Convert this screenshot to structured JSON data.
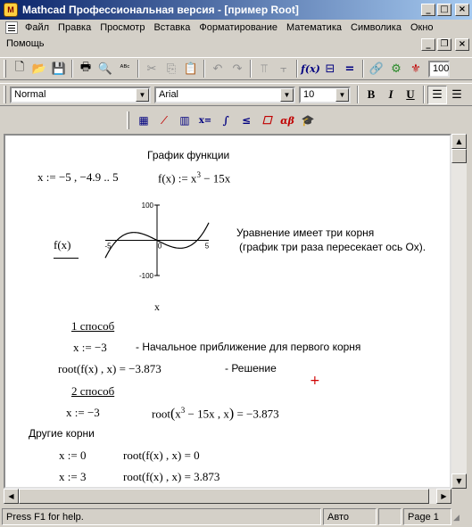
{
  "window": {
    "title": "Mathcad Профессиональная версия - [пример Root]",
    "app_icon_letter": "M",
    "min": "_",
    "max": "□",
    "close": "×"
  },
  "menu": {
    "items": [
      "Файл",
      "Правка",
      "Просмотр",
      "Вставка",
      "Форматирование",
      "Математика",
      "Символика",
      "Окно"
    ],
    "help": "Помощь"
  },
  "mdi": {
    "min": "_",
    "restore": "❐",
    "close": "×"
  },
  "toolbar": {
    "zoom_value": "100"
  },
  "format_toolbar": {
    "style": "Normal",
    "font": "Arial",
    "size": "10",
    "bold": "B",
    "italic": "I",
    "underline": "U"
  },
  "math_toolbar": {
    "buttons": [
      "▦",
      "⁄",
      "▥",
      "x=",
      "∫",
      "≤",
      "☐",
      "αβ",
      "🎓"
    ]
  },
  "worksheet": {
    "heading": "График функции",
    "range_def": "x := −5 , −4.9 .. 5",
    "func_def_lhs": "f(x) := x",
    "func_def_exp": "3",
    "func_def_rhs": " − 15x",
    "plot_ylabel": "f(x)",
    "plot_xlabel": "x",
    "plot_note_1": "Уравнение имеет три корня",
    "plot_note_2": "(график три раза пересекает ось Ох).",
    "method1": "1 способ",
    "m1_guess": "x := −3",
    "m1_guess_note": "- Начальное приближение для первого корня",
    "m1_root": "root(f(x) , x) = −3.873",
    "m1_root_note": "- Решение",
    "method2": "2 способ",
    "m2_guess": "x := −3",
    "m2_root_pre": "root",
    "m2_root_exp": "3",
    "m2_root_body_a": "x",
    "m2_root_body_b": " − 15x , x",
    "m2_root_result": " = −3.873",
    "other_roots": "Другие корни",
    "r2_guess": "x := 0",
    "r2_root": "root(f(x) , x) = 0",
    "r3_guess": "x := 3",
    "r3_root": "root(f(x) , x) = 3.873"
  },
  "chart_data": {
    "type": "line",
    "series": [
      {
        "expr": "x^3 - 15x",
        "x_start": -5,
        "x_step": 0.1,
        "x_end": 5
      }
    ],
    "xlim": [
      -5,
      5
    ],
    "ylim": [
      -100,
      100
    ],
    "x_tick_labels": [
      "-5",
      "0",
      "5"
    ],
    "y_tick_labels": [
      "100",
      "-100"
    ],
    "xlabel": "x",
    "ylabel": "f(x)",
    "color": "#000000"
  },
  "status": {
    "help": "Press F1 for help.",
    "mode": "Авто",
    "page": "Page 1"
  }
}
